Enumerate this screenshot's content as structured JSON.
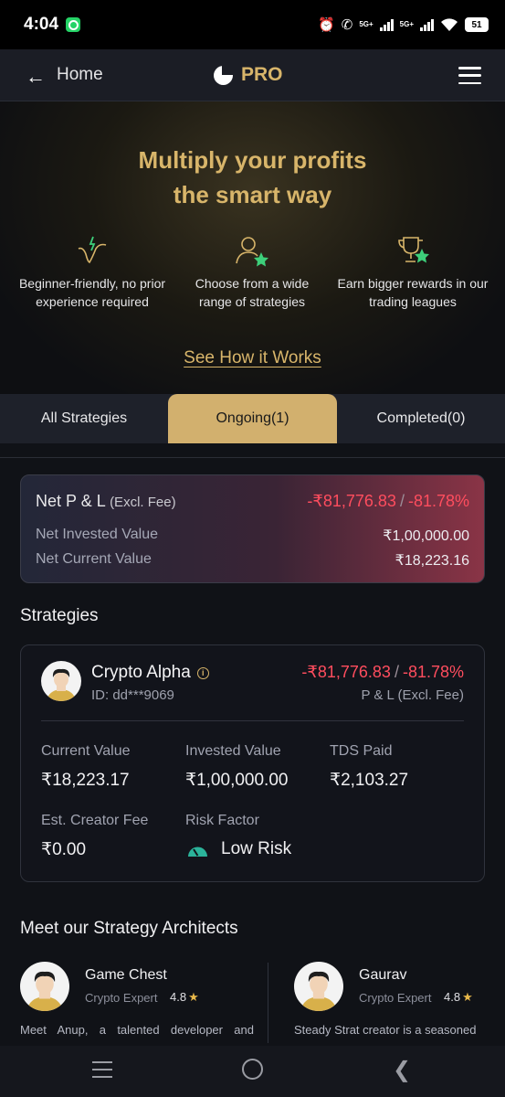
{
  "status_bar": {
    "time": "4:04",
    "net1": "5G+",
    "net2": "5G+",
    "battery": "51"
  },
  "header": {
    "back_label": "Home",
    "brand": "PRO"
  },
  "hero": {
    "title_line1": "Multiply your profits",
    "title_line2": "the smart way",
    "features": [
      {
        "icon": "chart-spark-icon",
        "line1": "Beginner-friendly, no prior",
        "line2": "experience required"
      },
      {
        "icon": "user-star-icon",
        "line1": "Choose from a wide",
        "line2": "range of strategies"
      },
      {
        "icon": "trophy-star-icon",
        "line1": "Earn bigger rewards in our",
        "line2": "trading leagues"
      }
    ],
    "cta": "See How it Works"
  },
  "tabs": [
    {
      "label": "All Strategies",
      "active": false
    },
    {
      "label": "Ongoing(1)",
      "active": true
    },
    {
      "label": "Completed(0)",
      "active": false
    }
  ],
  "pnl_summary": {
    "title": "Net P & L",
    "title_suffix": "(Excl. Fee)",
    "amount": "-₹81,776.83",
    "separator": "/",
    "percent": "-81.78%",
    "invested_label": "Net Invested Value",
    "invested_value": "₹1,00,000.00",
    "current_label": "Net Current Value",
    "current_value": "₹18,223.16"
  },
  "strategies_title": "Strategies",
  "strategy": {
    "name": "Crypto Alpha",
    "id": "ID: dd***9069",
    "pnl_amount": "-₹81,776.83",
    "separator": "/",
    "pnl_percent": "-81.78%",
    "pnl_label": "P & L (Excl. Fee)",
    "current_label": "Current Value",
    "current_value": "₹18,223.17",
    "invested_label": "Invested Value",
    "invested_value": "₹1,00,000.00",
    "tds_label": "TDS Paid",
    "tds_value": "₹2,103.27",
    "fee_label": "Est. Creator Fee",
    "fee_value": "₹0.00",
    "risk_label": "Risk Factor",
    "risk_value": "Low Risk"
  },
  "architects_title": "Meet our Strategy Architects",
  "architects": [
    {
      "name": "Game Chest",
      "role": "Crypto Expert",
      "rating": "4.8",
      "desc": "Meet Anup, a talented developer and"
    },
    {
      "name": "Gaurav",
      "role": "Crypto Expert",
      "rating": "4.8",
      "desc": "Steady Strat creator is a seasoned"
    }
  ],
  "colors": {
    "gold": "#d8b56a",
    "loss": "#ff4d5e",
    "tab_active": "#d2b06e",
    "low_risk": "#2bb39a"
  }
}
